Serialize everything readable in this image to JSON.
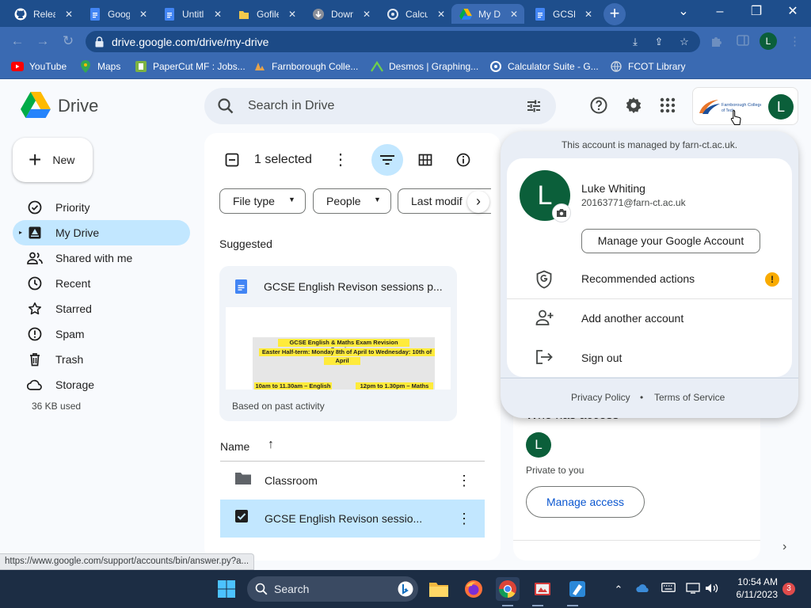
{
  "browser": {
    "tabs": [
      {
        "title": "Relea",
        "icon": "github-icon"
      },
      {
        "title": "Goog",
        "icon": "google-docs-icon"
      },
      {
        "title": "Untitl",
        "icon": "google-docs-icon"
      },
      {
        "title": "Gofile",
        "icon": "gofile-icon"
      },
      {
        "title": "Down",
        "icon": "download-icon"
      },
      {
        "title": "Calcu",
        "icon": "calculator-icon"
      },
      {
        "title": "My D",
        "icon": "google-drive-icon"
      },
      {
        "title": "GCSE",
        "icon": "google-docs-icon"
      }
    ],
    "active_tab_index": 6,
    "url": "drive.google.com/drive/my-drive",
    "profile_initial": "L",
    "bookmarks": [
      "YouTube",
      "Maps",
      "PaperCut MF : Jobs...",
      "Farnborough Colle...",
      "Desmos | Graphing...",
      "Calculator Suite - G...",
      "FCOT Library"
    ],
    "status_url": "https://www.google.com/support/accounts/bin/answer.py?a..."
  },
  "drive": {
    "product_name": "Drive",
    "search_placeholder": "Search in Drive",
    "new_button": "New",
    "account_initial": "L",
    "sidebar": [
      {
        "label": "Priority",
        "icon": "priority-check-icon"
      },
      {
        "label": "My Drive",
        "icon": "my-drive-icon",
        "active": true
      },
      {
        "label": "Shared with me",
        "icon": "shared-people-icon"
      },
      {
        "label": "Recent",
        "icon": "clock-icon"
      },
      {
        "label": "Starred",
        "icon": "star-icon"
      },
      {
        "label": "Spam",
        "icon": "spam-icon"
      },
      {
        "label": "Trash",
        "icon": "trash-icon"
      },
      {
        "label": "Storage",
        "icon": "cloud-icon"
      }
    ],
    "storage_used": "36 KB used",
    "selection": "1 selected",
    "filters": [
      "File type",
      "People",
      "Last modif"
    ],
    "suggested": {
      "heading": "Suggested",
      "file_title": "GCSE English Revison sessions p...",
      "reason": "Based on past activity",
      "thumb_lines": [
        "GCSE English & Maths Exam Revision Sessions",
        "Easter Half-term: Monday 8th of April  to Wednesday: 10th of",
        "April",
        "10am to 11.30am – English",
        "12pm to 1.30pm – Maths"
      ]
    },
    "list": {
      "name_header": "Name",
      "rows": [
        {
          "name": "Classroom",
          "type": "folder",
          "selected": false
        },
        {
          "name": "GCSE English Revison sessio...",
          "type": "document",
          "selected": true
        }
      ]
    },
    "details": {
      "who_has_access": "Who has access",
      "avatar_initial": "L",
      "private_text": "Private to you",
      "manage_access": "Manage access"
    }
  },
  "account_popup": {
    "managed_by": "This account is managed by farn-ct.ac.uk.",
    "initial": "L",
    "name": "Luke Whiting",
    "email": "20163771@farn-ct.ac.uk",
    "manage_account": "Manage your Google Account",
    "recommended": "Recommended actions",
    "recommended_badge": "!",
    "add_account": "Add another account",
    "sign_out": "Sign out",
    "privacy": "Privacy Policy",
    "separator": "•",
    "terms": "Terms of Service",
    "org_logo_text": "Farnborough College"
  },
  "taskbar": {
    "search_label": "Search",
    "time": "10:54 AM",
    "date": "6/11/2023",
    "notification_count": "3"
  },
  "colors": {
    "chrome_frame": "#1e4e8c",
    "chrome_toolbar": "#3a6ab2",
    "drive_selected": "#c2e7ff",
    "avatar_green": "#0b5f3a",
    "link_blue": "#0b57d0",
    "alert_yellow": "#f9ab00"
  }
}
